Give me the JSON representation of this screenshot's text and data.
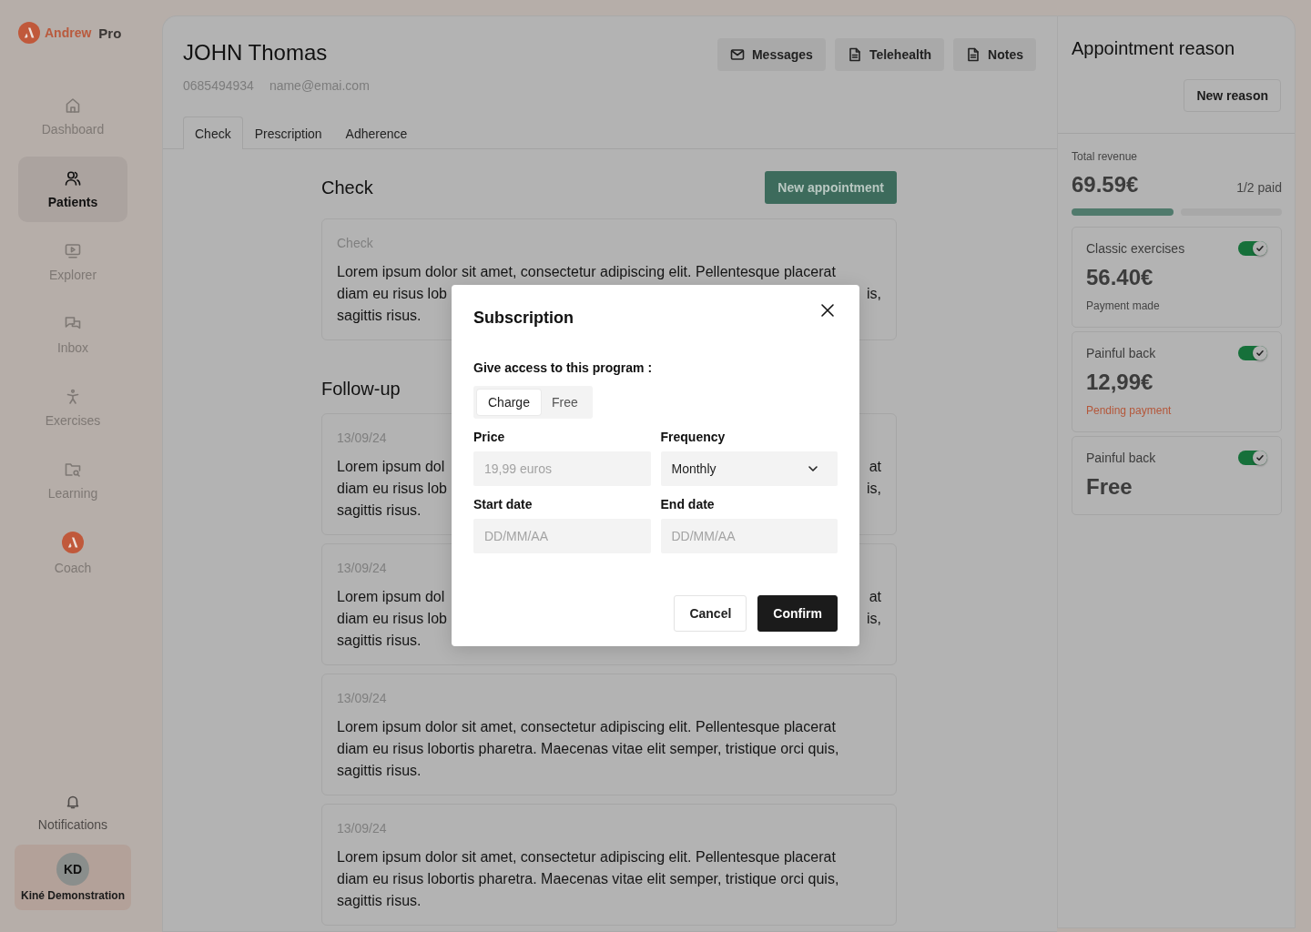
{
  "brand": {
    "name": "Andrew",
    "suffix": "Pro"
  },
  "nav": [
    {
      "label": "Dashboard",
      "selected": false
    },
    {
      "label": "Patients",
      "selected": true
    },
    {
      "label": "Explorer",
      "selected": false
    },
    {
      "label": "Inbox",
      "selected": false
    },
    {
      "label": "Exercises",
      "selected": false
    },
    {
      "label": "Learning",
      "selected": false
    },
    {
      "label": "Coach",
      "selected": false
    }
  ],
  "notifications": {
    "label": "Notifications"
  },
  "user": {
    "initials": "KD",
    "name": "Kiné Demonstration"
  },
  "patient": {
    "name": "JOHN Thomas",
    "phone": "0685494934",
    "email": "name@emai.com"
  },
  "actions": [
    {
      "label": "Messages"
    },
    {
      "label": "Telehealth"
    },
    {
      "label": "Notes"
    }
  ],
  "tabs": [
    {
      "label": "Check",
      "selected": true
    },
    {
      "label": "Prescription",
      "selected": false
    },
    {
      "label": "Adherence",
      "selected": false
    }
  ],
  "check": {
    "title": "Check",
    "button": "New appointment",
    "card": {
      "label": "Check",
      "lines": [
        {
          "left": "Lorem ipsum dolor sit amet, consectetur adipiscing elit. Pellentesque placerat"
        },
        {
          "left": "diam eu risus lob",
          "right": "is,"
        },
        {
          "left": "sagittis risus."
        }
      ]
    }
  },
  "follow_up": {
    "title": "Follow-up",
    "cards": [
      {
        "date": "13/09/24",
        "lines": [
          {
            "left": "Lorem ipsum dol",
            "right": "at"
          },
          {
            "left": "diam eu risus lob",
            "right": "is,"
          },
          {
            "left": "sagittis risus."
          }
        ]
      },
      {
        "date": "13/09/24",
        "lines": [
          {
            "left": "Lorem ipsum dol",
            "right": "at"
          },
          {
            "left": "diam eu risus lob",
            "right": "is,"
          },
          {
            "left": "sagittis risus."
          }
        ]
      },
      {
        "date": "13/09/24",
        "lines": [
          {
            "left": "Lorem ipsum dolor sit amet, consectetur adipiscing elit. Pellentesque placerat"
          },
          {
            "left": "diam eu risus lobortis pharetra. Maecenas vitae elit semper, tristique orci quis,"
          },
          {
            "left": "sagittis risus."
          }
        ]
      },
      {
        "date": "13/09/24",
        "lines": [
          {
            "left": "Lorem ipsum dolor sit amet, consectetur adipiscing elit. Pellentesque placerat"
          },
          {
            "left": "diam eu risus lobortis pharetra. Maecenas vitae elit semper, tristique orci quis,"
          },
          {
            "left": "sagittis risus."
          }
        ]
      }
    ]
  },
  "appointment_reason": {
    "title": "Appointment reason",
    "button": "New reason"
  },
  "revenue": {
    "label": "Total revenue",
    "amount": "69.59€",
    "paid": "1/2 paid",
    "level": 0.5
  },
  "reasons": [
    {
      "name": "Classic exercises",
      "on": true,
      "amount": "56.40€",
      "status": "Payment made",
      "kind": "paid"
    },
    {
      "name": "Painful back",
      "on": true,
      "amount": "12,99€",
      "status": "Pending payment",
      "kind": "pending"
    },
    {
      "name": "Painful back",
      "on": true,
      "amount": "Free"
    }
  ],
  "modal": {
    "title": "Subscription",
    "access_label": "Give access to this program :",
    "options": [
      {
        "label": "Charge",
        "selected": true
      },
      {
        "label": "Free",
        "selected": false
      }
    ],
    "fields": [
      {
        "label": "Price",
        "kind": "input",
        "placeholder": "19,99 euros"
      },
      {
        "label": "Frequency",
        "kind": "select",
        "value": "Monthly"
      },
      {
        "label": "Start date",
        "kind": "input",
        "placeholder": "DD/MM/AA"
      },
      {
        "label": "End date",
        "kind": "input",
        "placeholder": "DD/MM/AA"
      }
    ],
    "buttons": [
      {
        "label": "Cancel",
        "kind": "secondary"
      },
      {
        "label": "Confirm",
        "kind": "primary"
      }
    ]
  }
}
